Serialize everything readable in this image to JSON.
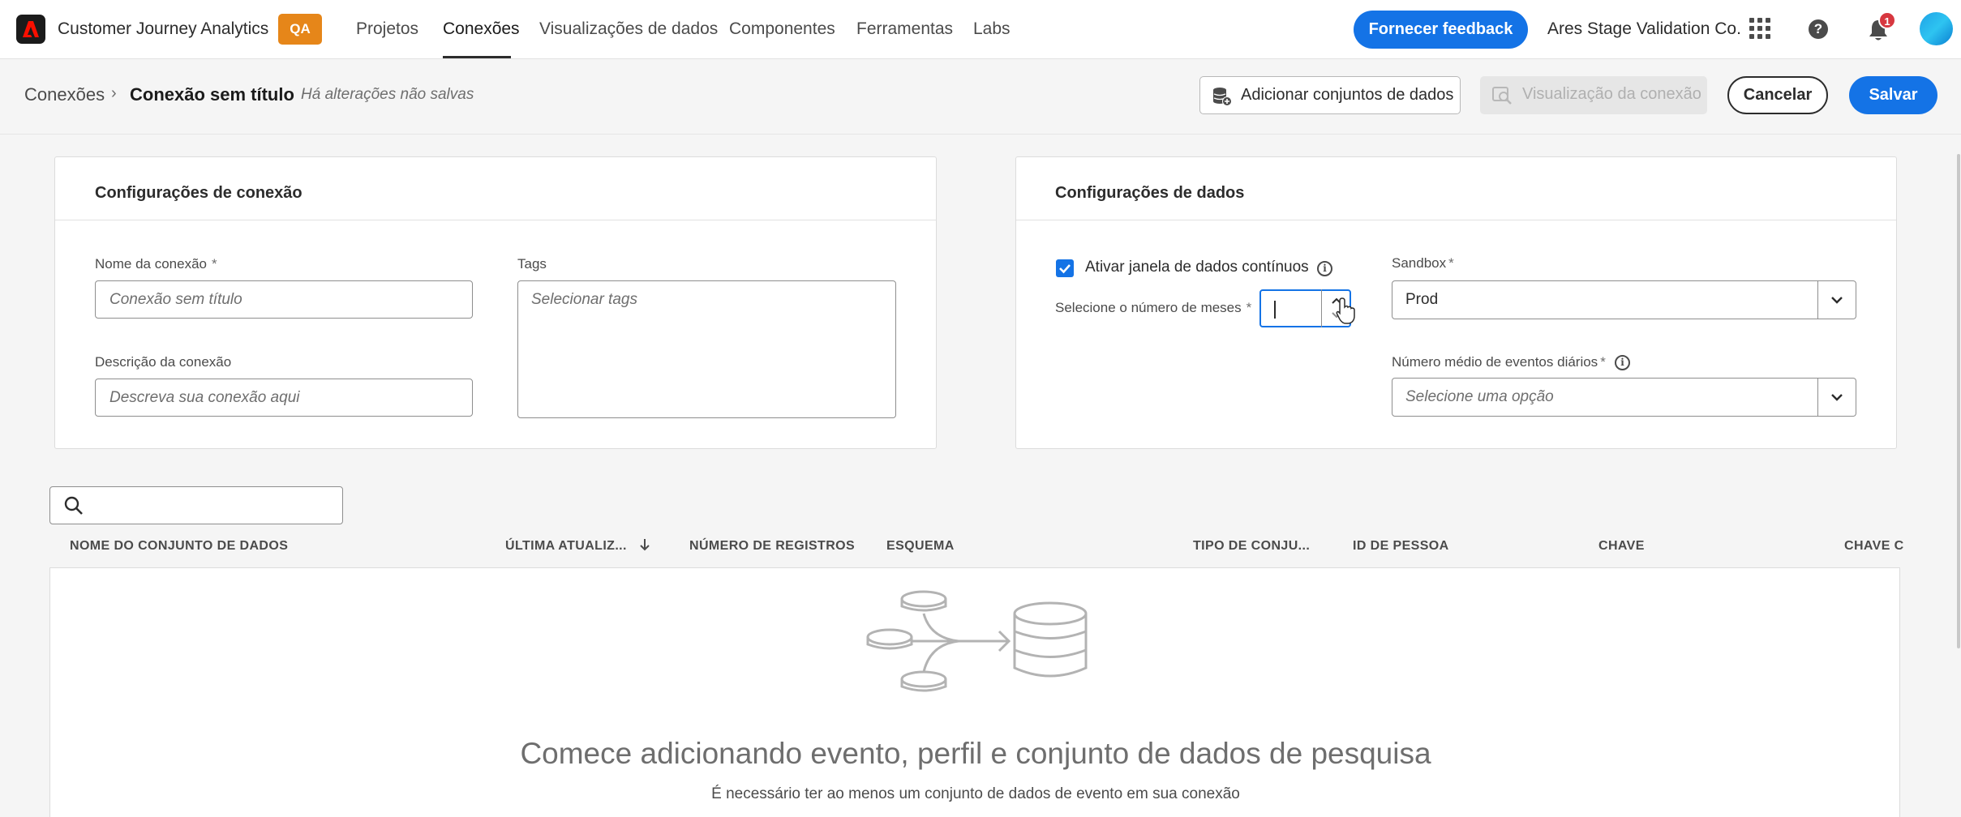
{
  "app": {
    "name": "Customer Journey Analytics",
    "env_badge": "QA"
  },
  "nav": {
    "items": [
      {
        "label": "Projetos"
      },
      {
        "label": "Conexões"
      },
      {
        "label": "Visualizações de dados"
      },
      {
        "label": "Componentes"
      },
      {
        "label": "Ferramentas"
      },
      {
        "label": "Labs"
      }
    ],
    "active": "Conexões"
  },
  "topbar": {
    "feedback_label": "Fornecer feedback",
    "org_name": "Ares Stage Validation Co.",
    "help_glyph": "?",
    "notifications_count": "1"
  },
  "breadcrumb": {
    "root": "Conexões",
    "separator": "›",
    "current": "Conexão sem título",
    "status": "Há alterações não salvas"
  },
  "actions": {
    "add_datasets": "Adicionar conjuntos de dados",
    "preview": "Visualização da conexão",
    "cancel": "Cancelar",
    "save": "Salvar"
  },
  "connection_settings": {
    "title": "Configurações de conexão",
    "name_label": "Nome da conexão",
    "name_placeholder": "Conexão sem título",
    "description_label": "Descrição da conexão",
    "description_placeholder": "Descreva sua conexão aqui",
    "tags_label": "Tags",
    "tags_placeholder": "Selecionar tags",
    "required_mark": "*"
  },
  "data_settings": {
    "title": "Configurações de dados",
    "rolling_window_label": "Ativar janela de dados contínuos",
    "rolling_window_checked": true,
    "months_label": "Selecione o número de meses",
    "months_value": "",
    "sandbox_label": "Sandbox",
    "sandbox_value": "Prod",
    "avg_events_label": "Número médio de eventos diários",
    "avg_events_placeholder": "Selecione uma opção",
    "info_glyph": "i",
    "required_mark": "*"
  },
  "table": {
    "search_placeholder": "",
    "columns": [
      {
        "label": "NOME DO CONJUNTO DE DADOS"
      },
      {
        "label": "ÚLTIMA ATUALIZ..."
      },
      {
        "label": "NÚMERO DE REGISTROS"
      },
      {
        "label": "ESQUEMA"
      },
      {
        "label": "TIPO DE CONJU..."
      },
      {
        "label": "ID DE PESSOA"
      },
      {
        "label": "CHAVE"
      },
      {
        "label": "CHAVE C"
      }
    ],
    "sorted_column": "ÚLTIMA ATUALIZ...",
    "sort_direction": "descending",
    "empty_title": "Comece adicionando evento, perfil e conjunto de dados de pesquisa",
    "empty_subtitle": "É necessário ter ao menos um conjunto de dados de evento em sua conexão"
  },
  "colors": {
    "accent": "#1473e6",
    "badge": "#e68619",
    "notification": "#d7373f"
  }
}
